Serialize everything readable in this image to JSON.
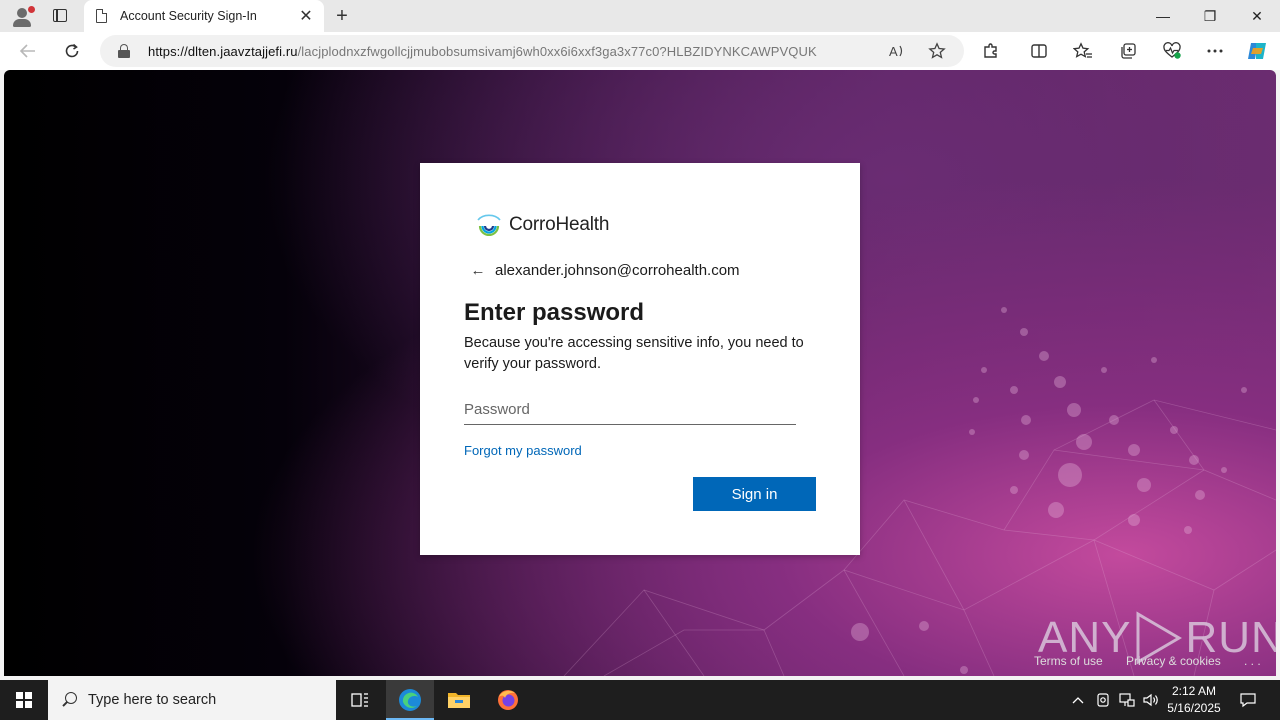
{
  "browser": {
    "tab_title": "Account Security Sign-In",
    "tab_close": "✕",
    "new_tab": "+",
    "url_host": "https://dlten.jaavztajjefi.ru",
    "url_path": "/lacjplodnxzfwgollcjjmubobsumsivamj6wh0xx6i6xxf3ga3x77c0?HLBZIDYNKCAWPVQUK",
    "minimize": "—",
    "restore": "❐",
    "close": "✕"
  },
  "signin": {
    "brand": "CorroHealth",
    "email": "alexander.johnson@corrohealth.com",
    "back_arrow": "←",
    "heading": "Enter password",
    "description": "Because you're accessing sensitive info, you need to verify your password.",
    "password_placeholder": "Password",
    "forgot_link": "Forgot my password",
    "signin_button": "Sign in"
  },
  "footer": {
    "terms": "Terms of use",
    "privacy": "Privacy & cookies",
    "more": ". . ."
  },
  "watermark": {
    "left": "ANY",
    "right": "RUN"
  },
  "taskbar": {
    "search_placeholder": "Type here to search",
    "time": "2:12 AM",
    "date": "5/16/2025"
  },
  "icons": {
    "profile": "profile-icon",
    "tabs": "tab-actions-icon",
    "back": "back-arrow-icon",
    "refresh": "refresh-icon",
    "lock": "lock-icon",
    "read_aloud": "read-aloud-icon",
    "favorite": "star-icon",
    "extensions": "puzzle-icon",
    "split": "split-screen-icon",
    "favorites": "favorites-icon",
    "collections": "collections-icon",
    "performance": "heart-pulse-icon",
    "more": "more-icon",
    "copilot": "copilot-icon"
  },
  "colors": {
    "primary_button": "#0067b8",
    "link": "#0067b8"
  }
}
